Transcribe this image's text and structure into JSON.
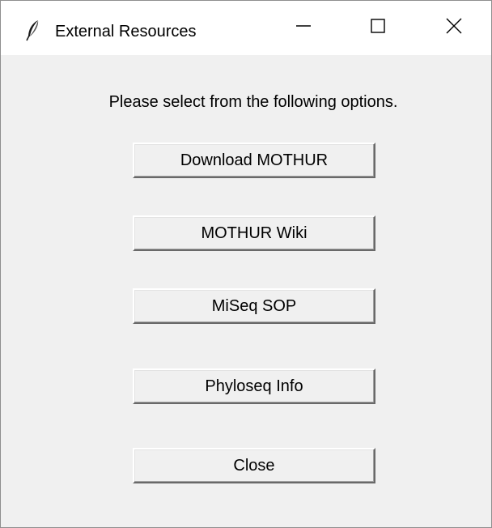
{
  "window": {
    "title": "External Resources",
    "icon": "feather-icon",
    "controls": {
      "minimize_icon": "minimize-icon",
      "maximize_icon": "maximize-icon",
      "close_icon": "close-icon"
    }
  },
  "main": {
    "prompt": "Please select from the following options.",
    "buttons": [
      {
        "label": "Download MOTHUR"
      },
      {
        "label": "MOTHUR Wiki"
      },
      {
        "label": "MiSeq SOP"
      },
      {
        "label": "Phyloseq Info"
      },
      {
        "label": "Close"
      }
    ]
  },
  "colors": {
    "window_background": "#f0f0f0",
    "titlebar_background": "#ffffff",
    "text": "#000000"
  }
}
